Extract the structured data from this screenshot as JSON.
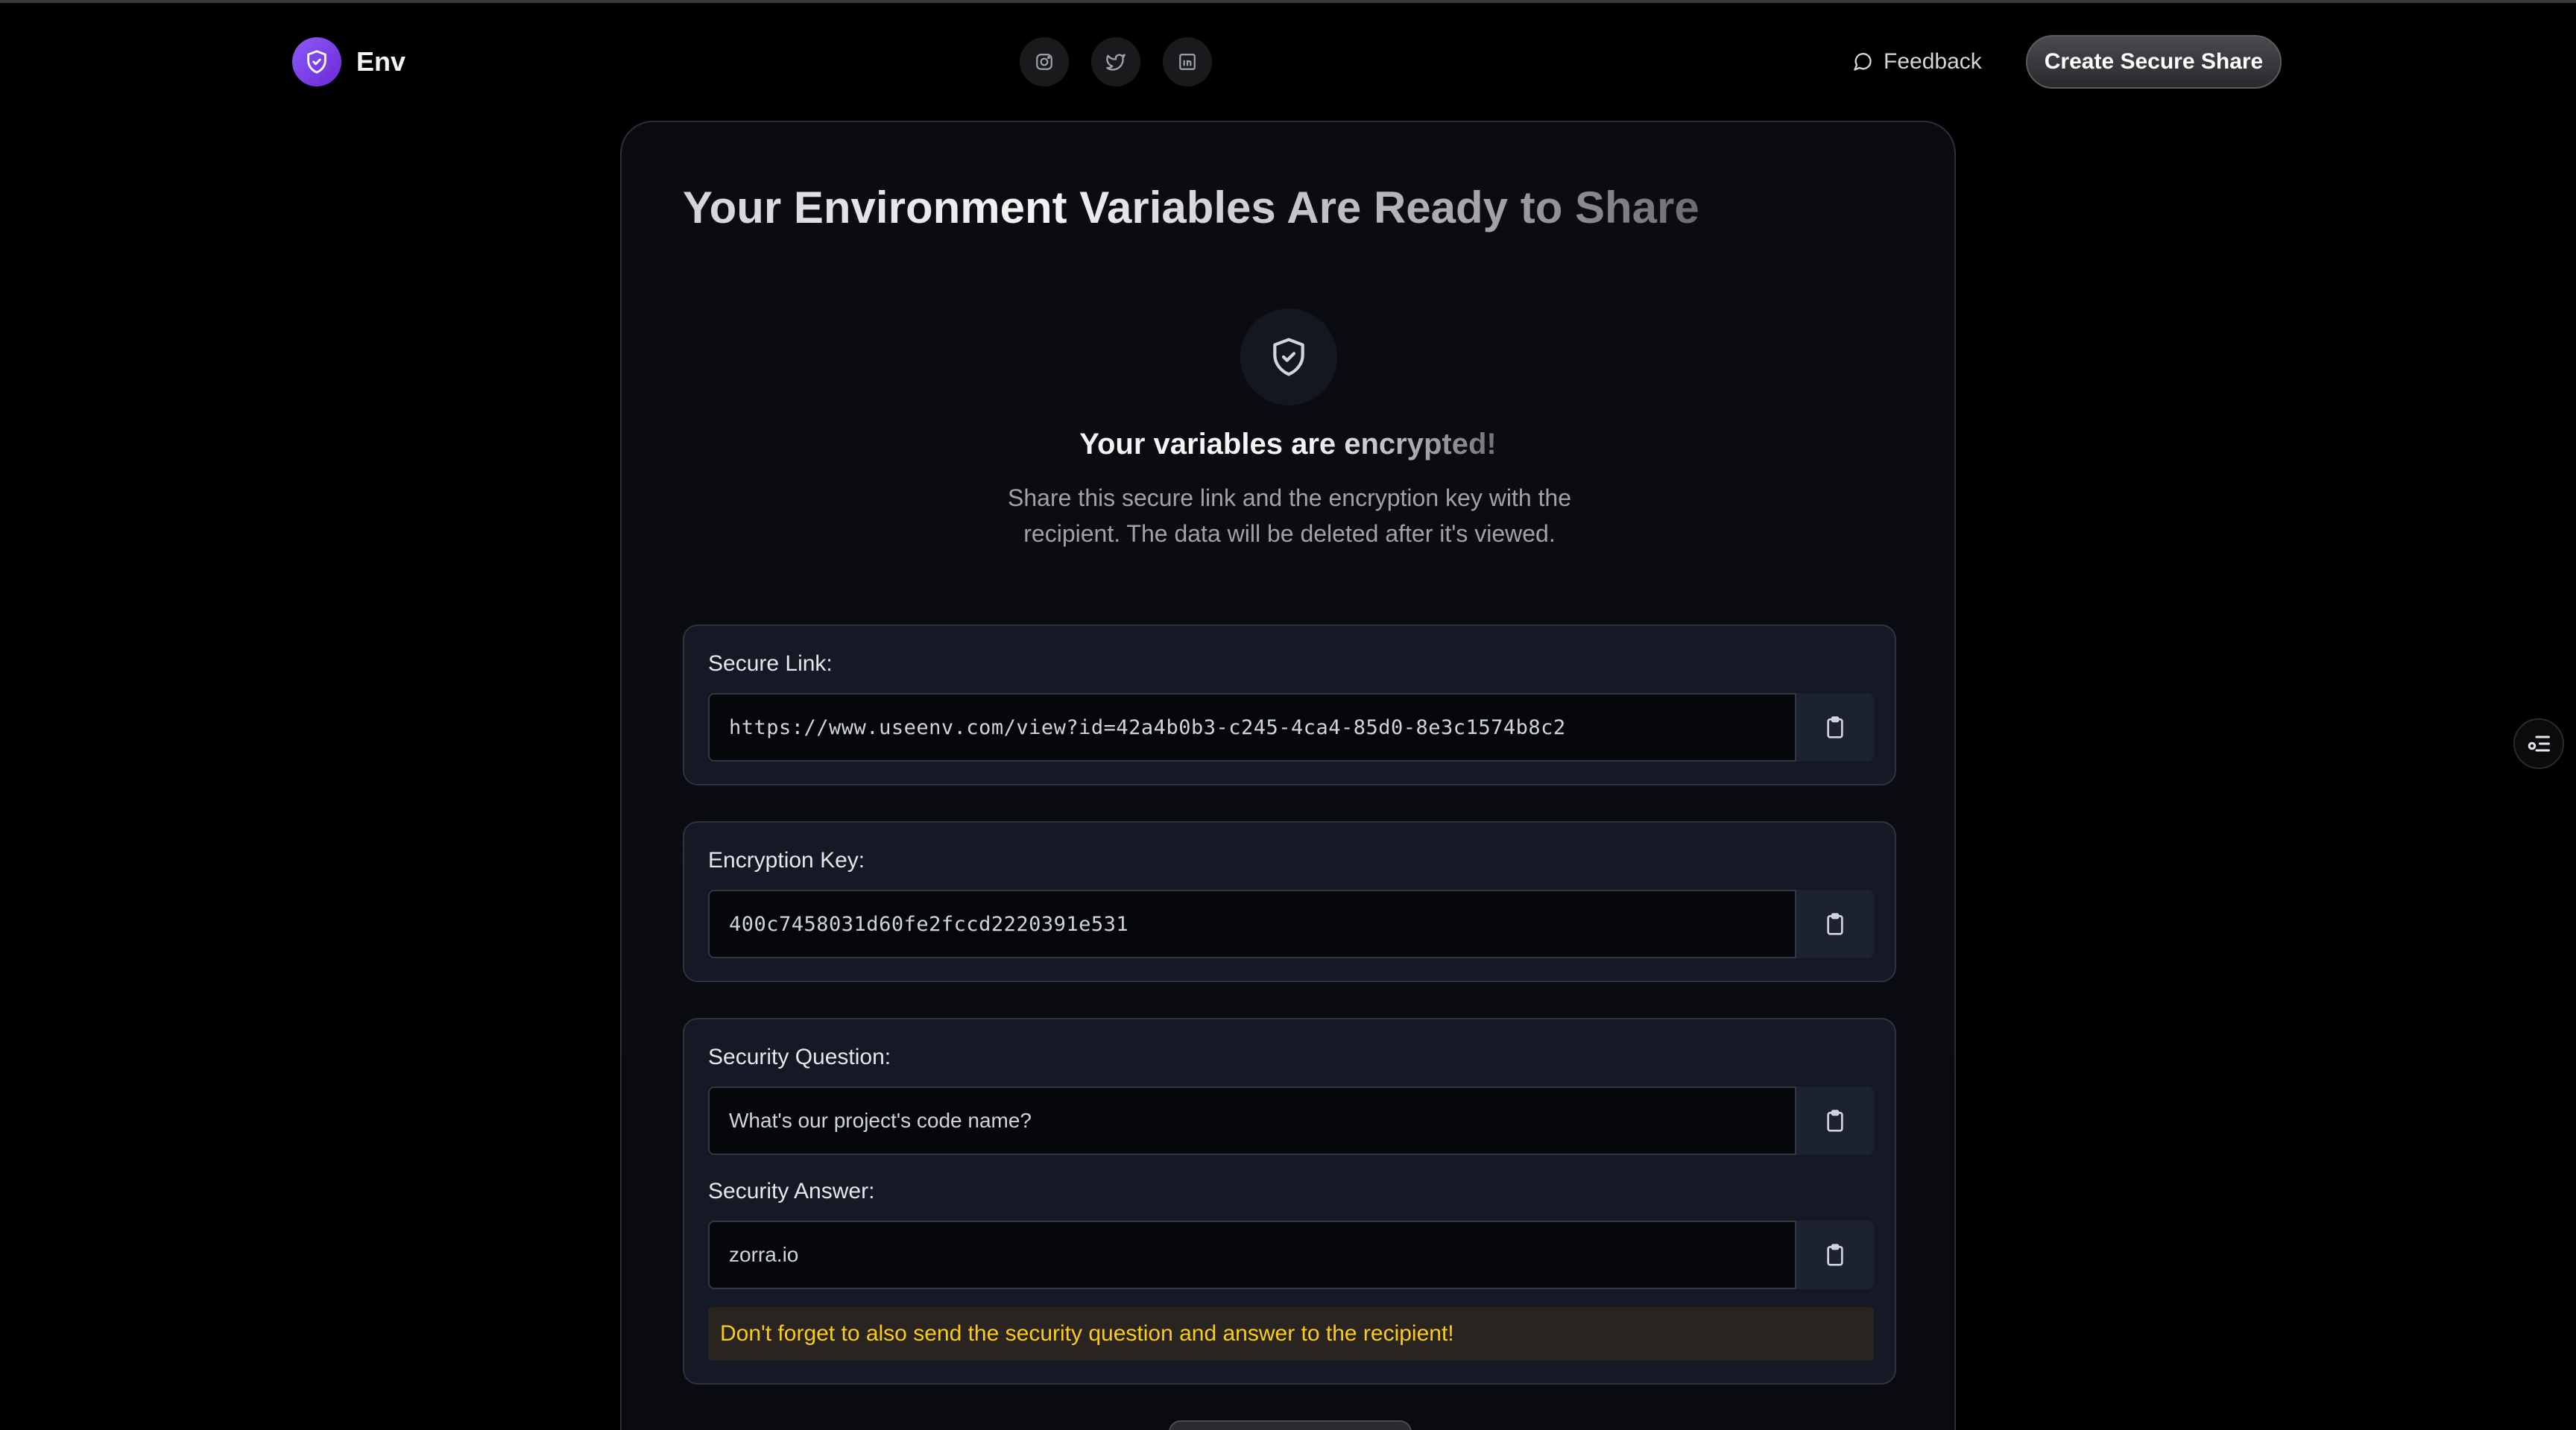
{
  "brand": {
    "name": "Env",
    "logo_icon": "shield-check-icon",
    "accent": "#7c3aed"
  },
  "socials": [
    {
      "name": "instagram-icon"
    },
    {
      "name": "twitter-icon"
    },
    {
      "name": "linkedin-icon"
    }
  ],
  "header": {
    "feedback_label": "Feedback",
    "cta_label": "Create Secure Share"
  },
  "card": {
    "title": "Your Environment Variables Are Ready to Share",
    "status_title": "Your variables are encrypted!",
    "status_desc": "Share this secure link and the encryption key with the recipient. The data will be deleted after it's viewed."
  },
  "secure_link": {
    "label": "Secure Link:",
    "value": "https://www.useenv.com/view?id=42a4b0b3-c245-4ca4-85d0-8e3c1574b8c2"
  },
  "encryption_key": {
    "label": "Encryption Key:",
    "value": "400c7458031d60fe2fccd2220391e531"
  },
  "security": {
    "question_label": "Security Question:",
    "question_value": "What's our project's code name?",
    "answer_label": "Security Answer:",
    "answer_value": "zorra.io",
    "warning": "Don't forget to also send the security question and answer to the recipient!",
    "warning_color": "#facc15"
  }
}
